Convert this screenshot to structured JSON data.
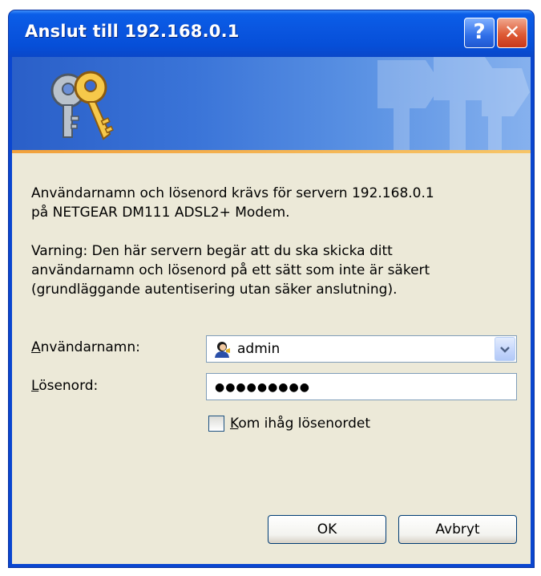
{
  "window": {
    "title": "Anslut till 192.168.0.1"
  },
  "title_buttons": {
    "help_label": "?",
    "close_label": "✕"
  },
  "message": {
    "line1": "Användarnamn och lösenord krävs för servern 192.168.0.1",
    "line2": "på NETGEAR DM111 ADSL2+ Modem."
  },
  "warning": {
    "line1": "Varning: Den här servern begär att du ska skicka ditt",
    "line2": "användarnamn och lösenord på ett sätt som inte är säkert",
    "line3": "(grundläggande autentisering utan säker anslutning)."
  },
  "form": {
    "username_label_key": "A",
    "username_label_rest": "nvändarnamn:",
    "username_value": "admin",
    "password_label_key": "L",
    "password_label_rest": "ösenord:",
    "password_value": "●●●●●●●●●",
    "remember_key": "K",
    "remember_rest": "om ihåg lösenordet",
    "remember_checked": false
  },
  "buttons": {
    "ok": "OK",
    "cancel": "Avbryt"
  },
  "colors": {
    "titlebar": "#0a56e0",
    "dialog_bg": "#ece9d8",
    "banner_accent": "#f2a13b"
  }
}
